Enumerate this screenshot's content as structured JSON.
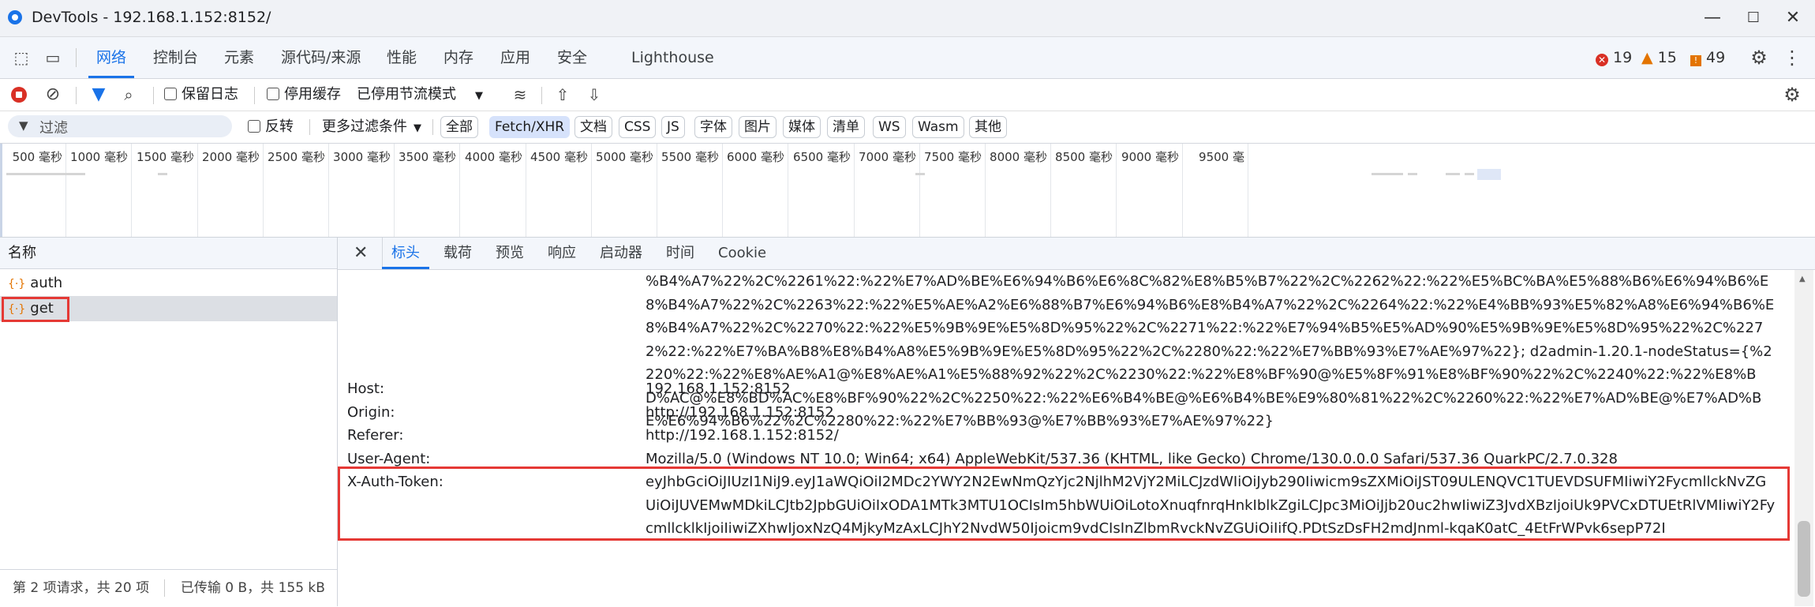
{
  "window": {
    "title": "DevTools - 192.168.1.152:8152/",
    "minimize_glyph": "—",
    "maximize_glyph": "☐",
    "close_glyph": "✕"
  },
  "main_tabs": [
    {
      "label": "网络",
      "active": true
    },
    {
      "label": "控制台"
    },
    {
      "label": "元素"
    },
    {
      "label": "源代码/来源"
    },
    {
      "label": "性能"
    },
    {
      "label": "内存"
    },
    {
      "label": "应用"
    },
    {
      "label": "安全"
    },
    {
      "label": "Lighthouse"
    }
  ],
  "issue_counts": {
    "errors": "19",
    "warnings": "15",
    "info": "49"
  },
  "toolbar": {
    "preserve_log": "保留日志",
    "disable_cache": "停用缓存",
    "throttling": "已停用节流模式"
  },
  "filter": {
    "placeholder": "过滤",
    "invert": "反转",
    "more_filters": "更多过滤条件",
    "chips": [
      "全部",
      "Fetch/XHR",
      "文档",
      "CSS",
      "JS",
      "字体",
      "图片",
      "媒体",
      "清单",
      "WS",
      "Wasm",
      "其他"
    ],
    "active_chip": "Fetch/XHR"
  },
  "timeline": {
    "ticks": [
      "500 毫秒",
      "1000 毫秒",
      "1500 毫秒",
      "2000 毫秒",
      "2500 毫秒",
      "3000 毫秒",
      "3500 毫秒",
      "4000 毫秒",
      "4500 毫秒",
      "5000 毫秒",
      "5500 毫秒",
      "6000 毫秒",
      "6500 毫秒",
      "7000 毫秒",
      "7500 毫秒",
      "8000 毫秒",
      "8500 毫秒",
      "9000 毫秒",
      "9500 毫"
    ]
  },
  "request_list": {
    "header": "名称",
    "items": [
      {
        "name": "auth",
        "icon": "{·}"
      },
      {
        "name": "get",
        "icon": "{·}",
        "selected": true
      }
    ],
    "status_requests": "第 2 项请求，共 20 项",
    "status_transfer": "已传输 0 B，共 155 kB"
  },
  "detail_tabs": [
    "标头",
    "载荷",
    "预览",
    "响应",
    "启动器",
    "时间",
    "Cookie"
  ],
  "headers": {
    "cookie_value": "%B4%A7%22%2C%2261%22:%22%E7%AD%BE%E6%94%B6%E6%8C%82%E8%B5%B7%22%2C%2262%22:%22%E5%BC%BA%E5%88%B6%E6%94%B6%E8%B4%A7%22%2C%2263%22:%22%E5%AE%A2%E6%88%B7%E6%94%B6%E8%B4%A7%22%2C%2264%22:%22%E4%BB%93%E5%82%A8%E6%94%B6%E8%B4%A7%22%2C%2270%22:%22%E5%9B%9E%E5%8D%95%22%2C%2271%22:%22%E7%94%B5%E5%AD%90%E5%9B%9E%E5%8D%95%22%2C%2272%22:%22%E7%BA%B8%E8%B4%A8%E5%9B%9E%E5%8D%95%22%2C%2280%22:%22%E7%BB%93%E7%AE%97%22}; d2admin-1.20.1-nodeStatus={%2220%22:%22%E8%AE%A1@%E8%AE%A1%E5%88%92%22%2C%2230%22:%22%E8%BF%90@%E5%8F%91%E8%BF%90%22%2C%2240%22:%22%E8%BD%AC@%E8%BD%AC%E8%BF%90%22%2C%2250%22:%22%E6%B4%BE@%E6%B4%BE%E9%80%81%22%2C%2260%22:%22%E7%AD%BE@%E7%AD%BE%E6%94%B6%22%2C%2280%22:%22%E7%BB%93@%E7%BB%93%E7%AE%97%22}",
    "rows": [
      {
        "name": "Host:",
        "value": "192.168.1.152:8152"
      },
      {
        "name": "Origin:",
        "value": "http://192.168.1.152:8152"
      },
      {
        "name": "Referer:",
        "value": "http://192.168.1.152:8152/"
      },
      {
        "name": "User-Agent:",
        "value": "Mozilla/5.0 (Windows NT 10.0; Win64; x64) AppleWebKit/537.36 (KHTML, like Gecko) Chrome/130.0.0.0 Safari/537.36 QuarkPC/2.7.0.328"
      }
    ],
    "token_name": "X-Auth-Token:",
    "token_value": "eyJhbGciOiJIUzI1NiJ9.eyJ1aWQiOiI2MDc2YWY2N2EwNmQzYjc2NjlhM2VjY2MiLCJzdWIiOiJyb290Iiwicm9sZXMiOiJST09ULENQVC1TUEVDSUFMIiwiY2FycmllckNvZGUiOiJUVEMwMDkiLCJtb2JpbGUiOiIxODA1MTk3MTU1OCIsIm5hbWUiOiLotoXnuqfnrqHnkIblkZgiLCJpc3MiOiJjb20uc2hwIiwiZ3JvdXBzIjoiUk9PVCxDTUEtRlVMIiwiY2FycmllcklkIjoiIiwiZXhwIjoxNzQ4MjkyMzAxLCJhY2NvdW50Ijoicm9vdCIsInZlbmRvckNvZGUiOiIifQ.PDtSzDsFH2mdJnml-kqaK0atC_4EtFrWPvk6sepP72I"
  },
  "colors": {
    "accent": "#1a73e8",
    "error": "#d93025",
    "warning": "#e37400",
    "highlight_box": "#e53935"
  }
}
